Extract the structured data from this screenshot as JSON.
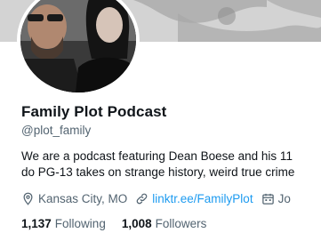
{
  "profile": {
    "display_name": "Family Plot Podcast",
    "handle": "@plot_family",
    "bio_lines": [
      "We are a podcast featuring Dean Boese and his 11",
      "do PG-13 takes on strange history, weird true crime"
    ],
    "location": "Kansas City, MO",
    "link": "linktr.ee/FamilyPlot",
    "joined_partial": "Jo"
  },
  "stats": {
    "following_count": "1,137",
    "following_label": "Following",
    "followers_count": "1,008",
    "followers_label": "Followers"
  },
  "icons": {
    "location": "location-pin-icon",
    "link": "link-icon",
    "calendar": "calendar-icon"
  },
  "colors": {
    "text_primary": "#0f1419",
    "text_secondary": "#536471",
    "link": "#1d9bf0"
  }
}
